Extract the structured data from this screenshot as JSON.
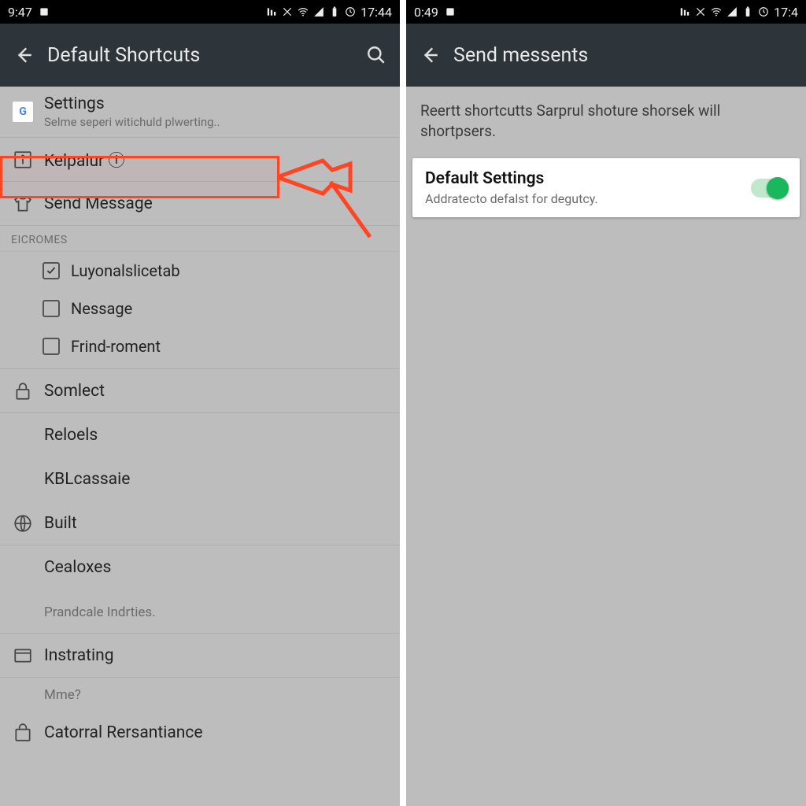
{
  "left": {
    "status": {
      "time_left": "9:47",
      "time_right": "17:44"
    },
    "appbar": {
      "title": "Default Shortcuts"
    },
    "rows": {
      "settings": {
        "label": "Settings",
        "sub": "Selme seperi witichuld plwerting.."
      },
      "kelpalur": {
        "label": "Kelpalur ⓘ"
      },
      "send_message": {
        "label": "Send Message"
      },
      "section": "EICROMES",
      "chk1": "Luyonalslicetab",
      "chk2": "Nessage",
      "chk3": "Frind-roment",
      "somlect": "Somlect",
      "reloels": "Reloels",
      "kbl": "KBLcassaie",
      "built": "Built",
      "cealoxes": "Cealoxes",
      "prandcale": "Prandcale Indrties.",
      "instrating": "Instrating",
      "mme": "Mme?",
      "catorral": "Catorral Rersantiance"
    }
  },
  "right": {
    "status": {
      "time_left": "0:49",
      "time_right": "17:4"
    },
    "appbar": {
      "title": "Send messents"
    },
    "desc": "Reertt shortcutts Sarprul shoture shorsek will shortpsers.",
    "card": {
      "title": "Default Settings",
      "sub": "Addratecto defalst for degutcy."
    }
  }
}
